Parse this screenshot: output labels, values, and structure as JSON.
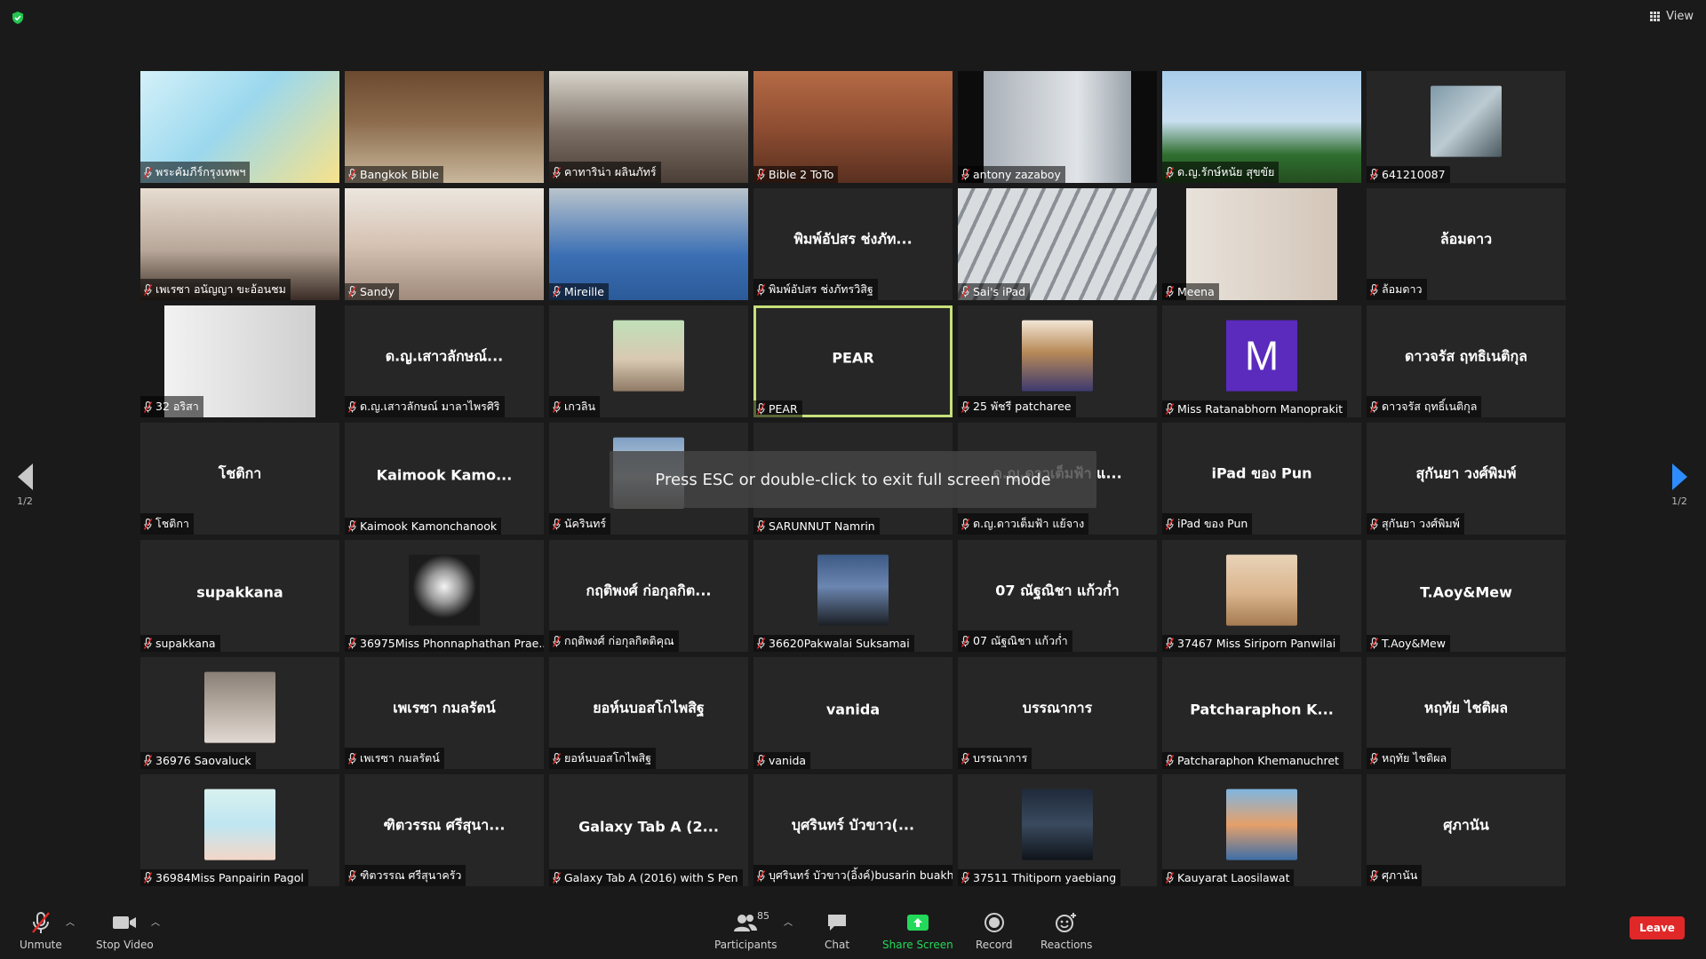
{
  "header": {
    "view_label": "View"
  },
  "tiles": [
    {
      "name": "พระคัมภีร์กรุงเทพฯ",
      "mode": "video",
      "bg": "linear-gradient(135deg,#d4f1f9 0%,#9bd8ee 45%,#f7e28a 100%)"
    },
    {
      "name": "Bangkok Bible",
      "mode": "video",
      "bg": "linear-gradient(180deg,#6b4a30 0%,#8c6b4c 45%,#c8b79c 100%)"
    },
    {
      "name": "คาทาริน่า ผลินภัทร์",
      "mode": "video",
      "bg": "linear-gradient(180deg,#d8d5cc 0%,#7a6d63 55%,#4a3e36 100%)"
    },
    {
      "name": "Bible 2 ToTo",
      "mode": "video",
      "bg": "linear-gradient(180deg,#b46a45 0%,#8f4e32 50%,#5a3020 100%)"
    },
    {
      "name": "antony zazaboy",
      "mode": "video",
      "bg": "linear-gradient(90deg,#0c0c0c 0%,#0c0c0c 13%,#aab0b8 13%,#e0e4e8 60%,#9aa3aa 87%,#0c0c0c 87%)"
    },
    {
      "name": "ด.ญ.รักษ์หนัย สุขขัย",
      "mode": "video",
      "bg": "linear-gradient(180deg,#a8cdea 0%,#c9dff0 45%,#2f6e2f 75%,#244e1f 100%)"
    },
    {
      "name": "641210087",
      "mode": "thumb",
      "bg": "linear-gradient(135deg,#7f9aa8 0%,#bccbd2 50%,#4b5a60 100%)"
    },
    {
      "name": "เพเรซา อนัญญา ขะอ้อนชม",
      "mode": "video",
      "bg": "linear-gradient(180deg,#e6dcd0 0%,#b9a89a 55%,#3a2d26 100%)"
    },
    {
      "name": "Sandy",
      "mode": "video",
      "bg": "linear-gradient(180deg,#ece6df 0%,#d6c3b4 50%,#9f8a7c 100%)"
    },
    {
      "name": "Mireille",
      "mode": "video",
      "bg": "linear-gradient(180deg,#b9c4cc 0%,#3b6fb4 60%,#2b5a98 100%)"
    },
    {
      "name": "พิมพ์อัปสร ช่งภัทรวิสิฐ",
      "mode": "text",
      "big": "พิมพ์อัปสร ช่งภัท..."
    },
    {
      "name": "Sai's iPad",
      "mode": "video",
      "bg": "repeating-linear-gradient(115deg,#d8dcdf 0 14px,#8a9095 14px 18px)"
    },
    {
      "name": "Meena",
      "mode": "video",
      "bg": "linear-gradient(90deg,#1a1a1a 0%,#1a1a1a 12%,#e8e2db 12%,#d3c6b8 88%,#1a1a1a 88%)"
    },
    {
      "name": "ล้อมดาว",
      "mode": "text",
      "big": "ล้อมดาว"
    },
    {
      "name": "32 อริสา",
      "mode": "video",
      "bg": "linear-gradient(90deg,#1a1a1a 0%,#1a1a1a 12%,#f2f2f2 12%,#cfcfcf 88%,#1a1a1a 88%)"
    },
    {
      "name": "ด.ญ.เสาวลักษณ์ มาลาไพรศิริ",
      "mode": "text",
      "big": "ด.ญ.เสาวลักษณ์..."
    },
    {
      "name": "เกวลิน",
      "mode": "thumb",
      "bg": "linear-gradient(180deg,#bfe0b8 0%,#d9c9b3 55%,#8f7a66 100%)"
    },
    {
      "name": "PEAR",
      "mode": "text",
      "big": "PEAR",
      "active": true
    },
    {
      "name": "25 พัชรี patcharee",
      "mode": "thumb",
      "bg": "linear-gradient(180deg,#f3e6d6 0%,#b88a58 45%,#3d3a6e 100%)"
    },
    {
      "name": "Miss Ratanabhorn Manoprakit",
      "mode": "avatar",
      "letter": "M"
    },
    {
      "name": "ดาวจรัส ฤทธิ์เนติกุล",
      "mode": "text",
      "big": "ดาวจรัส ฤทธิเนติกุล"
    },
    {
      "name": "โชติกา",
      "mode": "text",
      "big": "โชติกา"
    },
    {
      "name": "Kaimook Kamonchanook",
      "mode": "text",
      "big": "Kaimook Kamo..."
    },
    {
      "name": "นัครินทร์",
      "mode": "thumb",
      "bg": "linear-gradient(180deg,#7f9fc4 0%,#c7d4dc 55%,#6d6a68 100%)"
    },
    {
      "name": "SARUNNUT Namrin",
      "mode": "text",
      "big": ""
    },
    {
      "name": "ด.ญ.ดาวเต็มฟ้า แย้จาง",
      "mode": "text",
      "big": "ด.ญ.ดาวเต็มฟ้า แ..."
    },
    {
      "name": "iPad ของ Pun",
      "mode": "text",
      "big": "iPad ของ Pun"
    },
    {
      "name": "สุกันยา วงศ์พิมพ์",
      "mode": "text",
      "big": "สุกันยา วงศ์พิมพ์"
    },
    {
      "name": "supakkana",
      "mode": "text",
      "big": "supakkana"
    },
    {
      "name": "36975Miss Phonnaphathan Prae...",
      "mode": "thumb",
      "bg": "radial-gradient(circle at 50% 45%,#f4f4f4 0%,#9a9a9a 30%,#1c1c1c 60%)"
    },
    {
      "name": "กฤติพงศ์ ก่อกุลกิตติคุณ",
      "mode": "text",
      "big": "กฤติพงศ์ ก่อกุลกิต..."
    },
    {
      "name": "36620Pakwalai Suksamai",
      "mode": "thumb",
      "bg": "linear-gradient(180deg,#3c5a86 0%,#6b86b0 45%,#1c1f24 100%)"
    },
    {
      "name": "07 ณัฐณิชา แก้วก่ำ",
      "mode": "text",
      "big": "07 ณัฐณิชา แก้วก่ำ"
    },
    {
      "name": "37467 Miss Siriporn Panwilai",
      "mode": "thumb",
      "bg": "linear-gradient(180deg,#e9d3b8 0%,#d9b48c 55%,#a57b52 100%)"
    },
    {
      "name": "T.Aoy&Mew",
      "mode": "text",
      "big": "T.Aoy&Mew"
    },
    {
      "name": "36976 Saovaluck",
      "mode": "thumb",
      "bg": "linear-gradient(180deg,#8a7f76 0%,#b7aca2 50%,#e0d8d2 100%)"
    },
    {
      "name": "เพเรซา กมลรัตน์",
      "mode": "text",
      "big": "เพเรซา กมลรัตน์"
    },
    {
      "name": "ยอห์นบอสโกไพสิฐ",
      "mode": "text",
      "big": "ยอห์นบอสโกไพสิฐ"
    },
    {
      "name": "vanida",
      "mode": "text",
      "big": "vanida"
    },
    {
      "name": "บรรณาการ",
      "mode": "text",
      "big": "บรรณาการ"
    },
    {
      "name": "Patcharaphon Khemanuchret",
      "mode": "text",
      "big": "Patcharaphon  K..."
    },
    {
      "name": "หฤทัย ไชติผล",
      "mode": "text",
      "big": "หฤทัย ไชติผล"
    },
    {
      "name": "36984Miss Panpairin Pagol",
      "mode": "thumb",
      "bg": "linear-gradient(180deg,#d8f1ef 0%,#bfe6f2 50%,#f3d7c7 100%)"
    },
    {
      "name": "ฑิตวรรณ ศรีสุนาครัว",
      "mode": "text",
      "big": "ฑิตวรรณ ศรีสุนา..."
    },
    {
      "name": "Galaxy Tab A (2016) with S Pen",
      "mode": "text",
      "big": "Galaxy Tab A (2..."
    },
    {
      "name": "บุศรินทร์ บัวขาว(อิ้งค์)busarin buakh...",
      "mode": "text",
      "big": "บุศรินทร์ บัวขาว(..."
    },
    {
      "name": "37511 Thitiporn yaebiang",
      "mode": "thumb",
      "bg": "linear-gradient(180deg,#1f2a3a 0%,#3a4a5e 50%,#0f141b 100%)"
    },
    {
      "name": "Kauyarat Laosilawat",
      "mode": "thumb",
      "bg": "linear-gradient(180deg,#7fb6e0 0%,#e6a06a 50%,#3e6fa8 100%)"
    },
    {
      "name": "ศุภานัน",
      "mode": "text",
      "big": "ศุภานัน"
    }
  ],
  "pager": {
    "page": "1/2"
  },
  "toast": {
    "text": "Press ESC or double-click to exit full screen mode"
  },
  "toolbar": {
    "unmute": "Unmute",
    "stop_video": "Stop Video",
    "participants": "Participants",
    "participant_count": "85",
    "chat": "Chat",
    "share": "Share Screen",
    "record": "Record",
    "reactions": "Reactions",
    "leave": "Leave"
  },
  "colors": {
    "accent": "#2d8cff",
    "share": "#23d959",
    "leave": "#e02828",
    "mute": "#e02828",
    "active_border": "#c7e07a"
  }
}
